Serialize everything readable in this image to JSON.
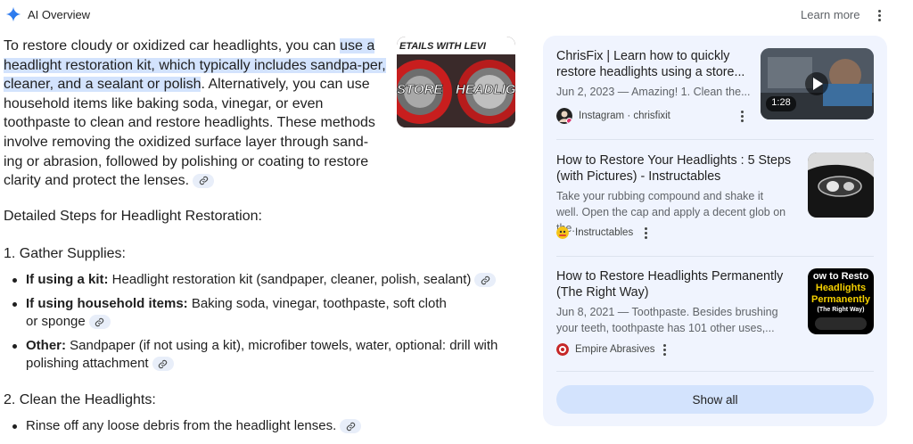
{
  "header": {
    "title": "AI Overview",
    "learn_more": "Learn more"
  },
  "intro": {
    "part1": "To restore cloudy or oxidized car headlights, you can ",
    "highlight": "use a headlight restoration kit, which typically includes sandpa-per, cleaner, and a sealant or polish",
    "part2": ". Alternatively, you can use household items like baking soda, vinegar, or even toothpaste to clean and restore headlights. These methods involve removing the oxidized surface layer through sand-ing or abrasion, followed by polishing or coating to restore clarity and protect the lenses.",
    "image_text_top": "ETAILS WITH LEVI",
    "image_text_left": "STORE",
    "image_text_right": "HEADLIGH"
  },
  "steps_heading": "Detailed Steps for Headlight Restoration:",
  "section1": {
    "heading": "1. Gather Supplies:",
    "items": [
      {
        "label": "If using a kit:",
        "text": " Headlight restoration kit (sandpaper, cleaner, polish, sealant)"
      },
      {
        "label": "If using household items:",
        "text": " Baking soda, vinegar, toothpaste, soft cloth or sponge"
      },
      {
        "label": "Other:",
        "text": " Sandpaper (if not using a kit), microfiber towels, water, optional: drill with polishing attachment"
      }
    ]
  },
  "section2": {
    "heading": "2. Clean the Headlights:",
    "items": [
      {
        "text": "Rinse off any loose debris from the headlight lenses."
      }
    ]
  },
  "sources": [
    {
      "title": "ChrisFix | Learn how to quickly restore headlights using a store...",
      "snippet": "Jun 2, 2023 — Amazing! 1. Clean the...",
      "source": "Instagram · chrisfixit",
      "duration": "1:28"
    },
    {
      "title": "How to Restore Your Headlights : 5 Steps (with Pictures) - Instructables",
      "snippet": "Take your rubbing compound and shake it well. Open the cap and apply a decent glob on the...",
      "source": "Instructables"
    },
    {
      "title": "How to Restore Headlights Permanently (The Right Way)",
      "snippet": "Jun 8, 2021 — Toothpaste. Besides brushing your teeth, toothpaste has 101 other uses,...",
      "source": "Empire Abrasives",
      "thumb_text_1": "ow to Resto",
      "thumb_text_2": "Headlights",
      "thumb_text_3": "Permanently",
      "thumb_text_4": "(The Right Way)"
    }
  ],
  "show_all": "Show all",
  "colors": {
    "highlight": "#d3e3fd",
    "panel": "#f0f4fe",
    "link_chip": "#e8eef9",
    "button": "#d3e3fd",
    "gemini_blue": "#4285f4"
  },
  "icons": [
    "gemini-sparkle-icon",
    "more-vert-icon",
    "link-icon",
    "play-icon",
    "instagram-icon",
    "instructables-icon",
    "empire-abrasives-icon"
  ]
}
